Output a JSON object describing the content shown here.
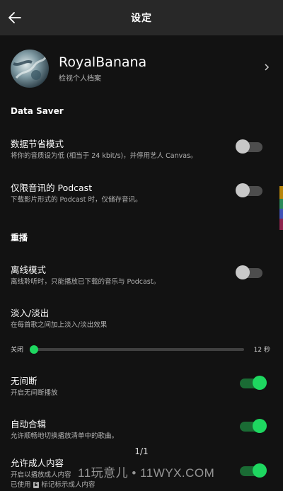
{
  "header": {
    "title": "设定"
  },
  "profile": {
    "name": "RoyalBanana",
    "subtitle": "检视个人档案"
  },
  "sections": {
    "data_saver": "Data Saver",
    "playback": "重播"
  },
  "settings": [
    {
      "title": "数据节省模式",
      "subtitle": "将你的音质设为低 (相当于 24 kbit/s)，并停用艺人 Canvas。",
      "on": false
    },
    {
      "title": "仅限音讯的 Podcast",
      "subtitle": "下载影片形式的 Podcast 时，仅储存音讯。",
      "on": false
    },
    {
      "title": "离线模式",
      "subtitle": "离线聆听时，只能播放已下载的音乐与 Podcast。",
      "on": false
    },
    {
      "title": "淡入/淡出",
      "subtitle": "在每首歌之间加上淡入/淡出效果"
    },
    {
      "title": "无间断",
      "subtitle": "开启无间断播放",
      "on": true
    },
    {
      "title": "自动合辑",
      "subtitle": "允许顺畅地切换播放清单中的歌曲。",
      "on": true
    },
    {
      "title": "允许成人内容",
      "subtitle": "开启以播放成人内容",
      "subtitle2_pre": "已使用",
      "badge": "E",
      "subtitle2_post": "标记标示成人内容",
      "on": true
    }
  ],
  "crossfade": {
    "min_label": "关闭",
    "max_label": "12 秒",
    "value_seconds": 0,
    "max_seconds": 12
  },
  "page_indicator": "1/1",
  "watermark": "11玩意儿 • 11WYX.COM",
  "colors": {
    "accent": "#1ed760",
    "background": "#121212",
    "header": "#282828"
  },
  "icons": {
    "back": "arrow-left-icon",
    "profile_chevron": "chevron-right-icon"
  }
}
